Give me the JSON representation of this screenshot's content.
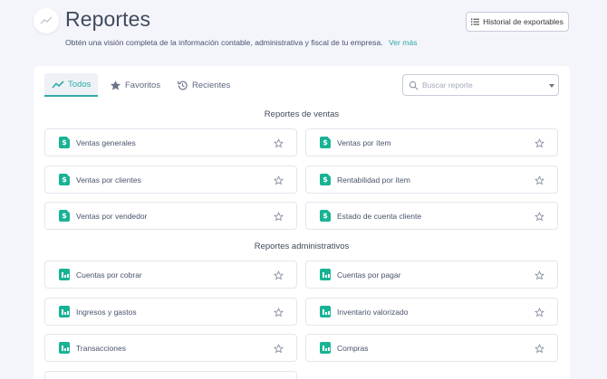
{
  "header": {
    "title": "Reportes",
    "subtitle": "Obtén una visión completa de la información contable, administrativa y fiscal de tu empresa.",
    "see_more": "Ver más",
    "export_button": "Historial de exportables"
  },
  "tabs": [
    {
      "label": "Todos",
      "icon": "trend-icon",
      "active": true
    },
    {
      "label": "Favoritos",
      "icon": "star-icon",
      "active": false
    },
    {
      "label": "Recientes",
      "icon": "history-icon",
      "active": false
    }
  ],
  "search": {
    "placeholder": "Buscar reporte"
  },
  "sections": [
    {
      "title": "Reportes de ventas",
      "icon": "document-dollar-icon",
      "items": [
        "Ventas generales",
        "Ventas por ítem",
        "Ventas por clientes",
        "Rentabilidad por ítem",
        "Ventas por vendedor",
        "Estado de cuenta cliente"
      ]
    },
    {
      "title": "Reportes administrativos",
      "icon": "bar-chart-icon",
      "items": [
        "Cuentas por cobrar",
        "Cuentas por pagar",
        "Ingresos y gastos",
        "Inventario valorizado",
        "Transacciones",
        "Compras"
      ]
    }
  ],
  "colors": {
    "accent": "#30aba9",
    "icon_green": "#18b394",
    "background": "#f4f5fb"
  }
}
